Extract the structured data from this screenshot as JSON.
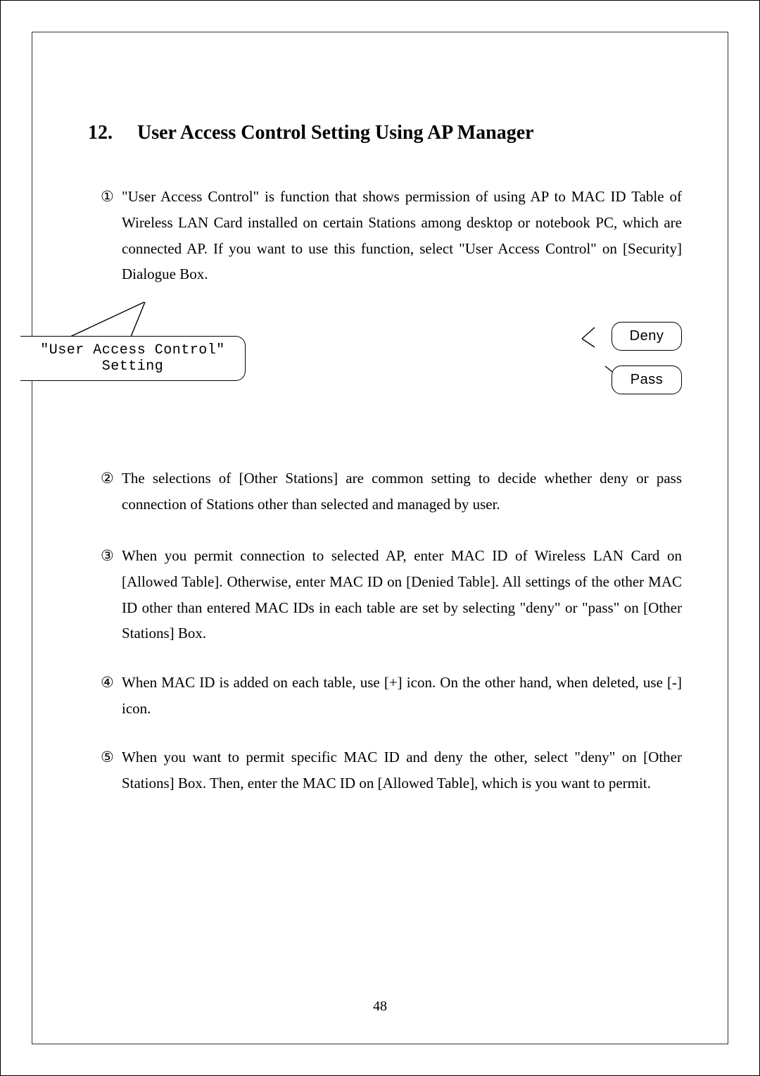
{
  "heading_number": "12.",
  "heading_text": "User Access Control Setting Using AP Manager",
  "items": [
    {
      "marker": "①",
      "text": "\"User Access Control\" is function that shows permission of using AP to MAC ID Table of Wireless LAN Card installed on certain Stations among desktop or notebook PC, which are connected AP. If you want to use this function, select \"User Access Control\" on [Security] Dialogue Box."
    },
    {
      "marker": "②",
      "text": "The selections of [Other Stations] are common setting to decide whether deny or pass connection of Stations other than selected and managed by user."
    },
    {
      "marker": "③",
      "text": "When you permit connection to selected AP, enter MAC ID of Wireless LAN Card on [Allowed Table]. Otherwise, enter MAC ID on [Denied Table]. All settings of the other MAC ID other than entered MAC IDs in each table are set by selecting \"deny\" or \"pass\" on [Other Stations] Box."
    },
    {
      "marker": "④",
      "text": "When MAC ID is added on each table, use [+] icon. On the other hand, when deleted, use [-] icon."
    },
    {
      "marker": "⑤",
      "text": "When you want to permit specific MAC ID and deny the other, select \"deny\" on [Other Stations] Box. Then, enter the MAC ID on [Allowed Table], which is you want to permit."
    }
  ],
  "diagram": {
    "left_label": "\"User Access Control\" Setting",
    "right_top": "Deny",
    "right_bottom": "Pass"
  },
  "page_number": "48"
}
